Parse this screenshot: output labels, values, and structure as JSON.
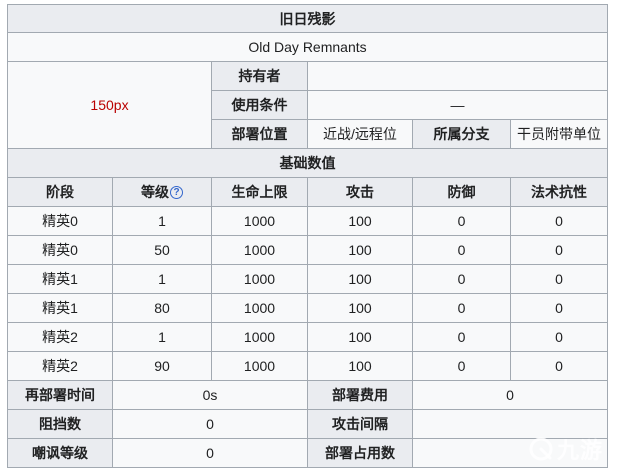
{
  "card": {
    "title": "旧日残影",
    "name": "Old Day Remnants",
    "image_placeholder": "150px",
    "labels": {
      "holder": "持有者",
      "condition": "使用条件",
      "position": "部署位置",
      "branch": "所属分支"
    },
    "values": {
      "holder": "",
      "condition": "—",
      "position": "近战/远程位",
      "branch": "干员附带单位"
    }
  },
  "stats": {
    "section_title": "基础数值",
    "help_icon": "?",
    "headers": [
      "阶段",
      "等级",
      "生命上限",
      "攻击",
      "防御",
      "法术抗性"
    ],
    "rows": [
      [
        "精英0",
        "1",
        "1000",
        "100",
        "0",
        "0"
      ],
      [
        "精英0",
        "50",
        "1000",
        "100",
        "0",
        "0"
      ],
      [
        "精英1",
        "1",
        "1000",
        "100",
        "0",
        "0"
      ],
      [
        "精英1",
        "80",
        "1000",
        "100",
        "0",
        "0"
      ],
      [
        "精英2",
        "1",
        "1000",
        "100",
        "0",
        "0"
      ],
      [
        "精英2",
        "90",
        "1000",
        "100",
        "0",
        "0"
      ]
    ]
  },
  "extra": {
    "redeploy_label": "再部署时间",
    "redeploy_value": "0s",
    "cost_label": "部署费用",
    "cost_value": "0",
    "block_label": "阻挡数",
    "block_value": "0",
    "interval_label": "攻击间隔",
    "interval_value": "",
    "taunt_label": "嘲讽等级",
    "taunt_value": "0",
    "slots_label": "部署占用数",
    "slots_value": ""
  },
  "watermark": {
    "text": "九游",
    "icon": "jiuyou-logo-icon"
  }
}
